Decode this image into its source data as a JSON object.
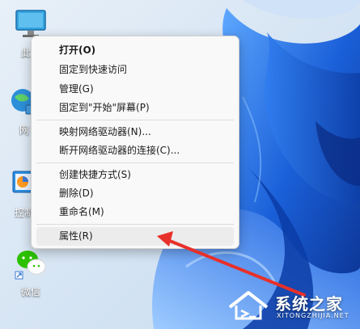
{
  "desktop_icons": [
    {
      "label": "此电",
      "icon": "monitor-icon"
    },
    {
      "label": "网",
      "icon": "network-icon"
    },
    {
      "label": "控制",
      "icon": "control-panel-icon"
    },
    {
      "label": "微信",
      "icon": "wechat-icon"
    }
  ],
  "context_menu": {
    "items": [
      {
        "label": "打开(O)",
        "bold": true
      },
      {
        "label": "固定到快速访问"
      },
      {
        "label": "管理(G)"
      },
      {
        "label": "固定到\"开始\"屏幕(P)"
      },
      {
        "label": "映射网络驱动器(N)..."
      },
      {
        "label": "断开网络驱动器的连接(C)..."
      },
      {
        "label": "创建快捷方式(S)"
      },
      {
        "label": "删除(D)"
      },
      {
        "label": "重命名(M)"
      },
      {
        "label": "属性(R)",
        "highlighted": true
      }
    ]
  },
  "watermark": {
    "title": "系统之家",
    "subtitle": "XITONGZHIJIA.NET"
  },
  "colors": {
    "arrow": "#e8302a",
    "wallpaper_blue": "#1a5fd8",
    "menu_bg": "#f9f9f9"
  }
}
